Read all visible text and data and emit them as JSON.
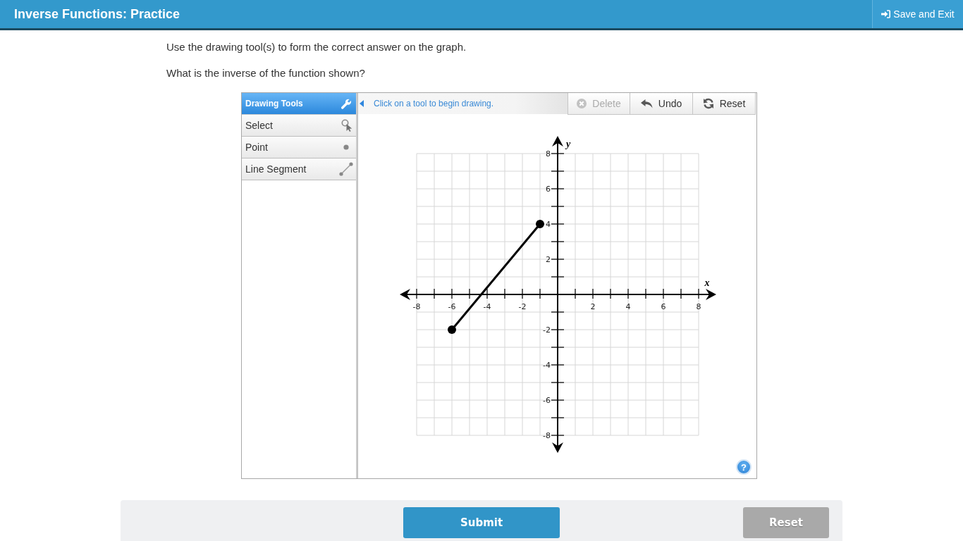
{
  "header": {
    "title": "Inverse Functions: Practice",
    "save_exit_button": "Save and Exit"
  },
  "instructions": [
    "Use the drawing tool(s) to form the correct answer on the graph.",
    "What is the inverse of the function shown?"
  ],
  "drawing_tools": {
    "title": "Drawing Tools",
    "items": [
      {
        "label": "Select",
        "kind": "select",
        "selected": false
      },
      {
        "label": "Point",
        "kind": "point",
        "selected": false
      },
      {
        "label": "Line Segment",
        "kind": "segment",
        "selected": false
      }
    ]
  },
  "toolbar": {
    "message": "Click on a tool to begin drawing.",
    "buttons": [
      {
        "label": "Delete",
        "kind": "delete",
        "disabled": true
      },
      {
        "label": "Undo",
        "kind": "undo",
        "disabled": false
      },
      {
        "label": "Reset",
        "kind": "reset",
        "disabled": false
      }
    ]
  },
  "graph": {
    "chart_data": {
      "type": "line",
      "xlabel": "x",
      "ylabel": "y",
      "x": [
        -6,
        -1
      ],
      "values": [
        -2,
        4
      ],
      "color": "#000000",
      "marker": "circle",
      "xlim": [
        -8,
        8
      ],
      "ylim": [
        -8,
        8
      ],
      "xticks": [
        -8,
        -6,
        -4,
        -2,
        2,
        4,
        6,
        8
      ],
      "yticks": [
        -8,
        -6,
        -4,
        -2,
        2,
        4,
        6,
        8
      ],
      "grid": true
    }
  },
  "help_button": {
    "label": "?"
  },
  "footer": {
    "submit": {
      "label": "Submit",
      "disabled": false
    },
    "reset": {
      "label": "Reset",
      "disabled": true
    }
  }
}
